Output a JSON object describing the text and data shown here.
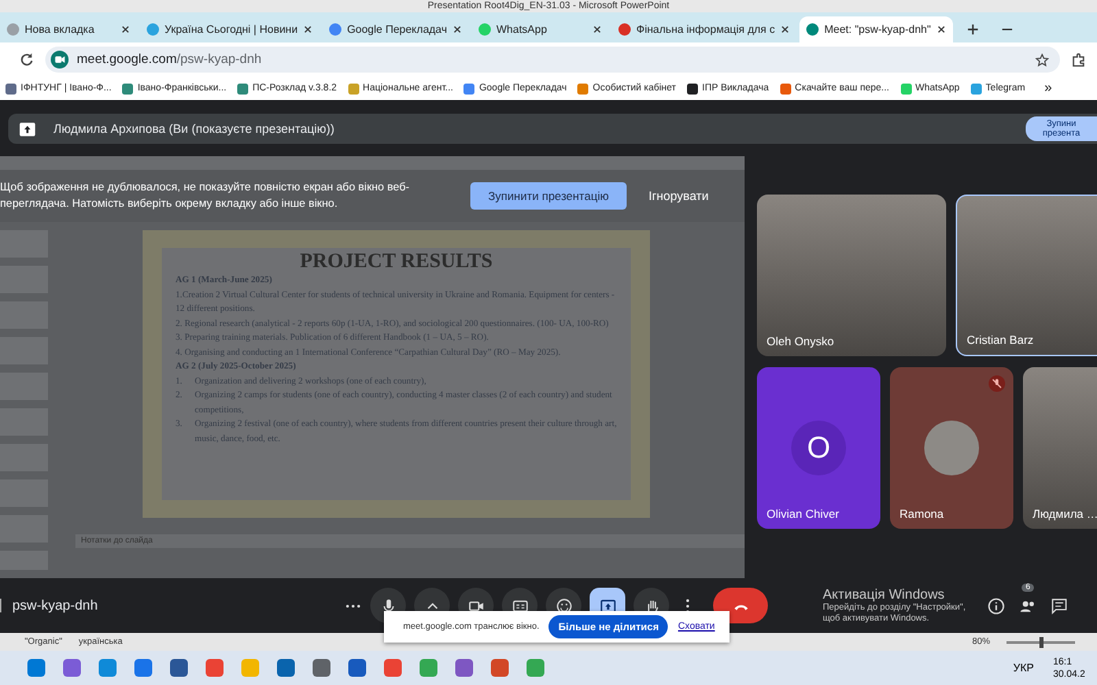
{
  "ppt_title": "Presentation Root4Dig_EN-31.03 - Microsoft PowerPoint",
  "browser": {
    "tabs": [
      {
        "label": "Нова вкладка",
        "selected": false,
        "color": "#9aa0a6"
      },
      {
        "label": "Україна Сьогодні | Новини",
        "selected": false,
        "color": "#2aa3de"
      },
      {
        "label": "Google Перекладач",
        "selected": false,
        "color": "#4285f4"
      },
      {
        "label": "WhatsApp",
        "selected": false,
        "color": "#25d366"
      },
      {
        "label": "Фінальна інформація для с",
        "selected": false,
        "color": "#d93025"
      },
      {
        "label": "Meet: \"psw-kyap-dnh\"",
        "selected": true,
        "color": "#00897b"
      }
    ],
    "url_host": "meet.google.com",
    "url_path": "/psw-kyap-dnh",
    "bookmarks": [
      {
        "label": "ІФНТУНГ | Івано-Ф...",
        "color": "#5f6b8a"
      },
      {
        "label": "Івано-Франківськи...",
        "color": "#2e8b7a"
      },
      {
        "label": "ПС-Розклад v.3.8.2",
        "color": "#2e8b7a"
      },
      {
        "label": "Національне агент...",
        "color": "#c9a227"
      },
      {
        "label": "Google Перекладач",
        "color": "#4285f4"
      },
      {
        "label": "Особистий кабінет",
        "color": "#e07b00"
      },
      {
        "label": "ІПР Викладача",
        "color": "#202124"
      },
      {
        "label": "Скачайте ваш пере...",
        "color": "#e8590c"
      },
      {
        "label": "WhatsApp",
        "color": "#25d366"
      },
      {
        "label": "Telegram",
        "color": "#2aa3de"
      }
    ],
    "more_bookmarks": "»"
  },
  "meet": {
    "presenter_bar": "Людмила Архипова (Ви (показуєте презентацію))",
    "stop_chip": "Зупини презента",
    "banner": {
      "text": "Щоб зображення не дублювалося, не показуйте повністю екран або вікно веб-переглядача. Натомість виберіть окрему вкладку або інше вікно.",
      "stop_button": "Зупинити презентацію",
      "ignore_button": "Ігнорувати"
    },
    "slide": {
      "title": "PROJECT RESULTS",
      "lines": [
        {
          "kind": "heading",
          "text": "AG 1 (March-June 2025)"
        },
        {
          "kind": "para",
          "text": "1.Creation 2 Virtual Cultural Center for students of technical university in Ukraine and Romania. Equipment for centers - 12 different positions."
        },
        {
          "kind": "para",
          "text": "2. Regional research (analytical - 2 reports 60p (1-UA, 1-RO), and sociological 200 questionnaires. (100- UA, 100-RO)"
        },
        {
          "kind": "para",
          "text": "3. Preparing training materials. Publication of 6 different Handbook (1 – UA, 5 – RO)."
        },
        {
          "kind": "para",
          "text": "4. Organising and conducting an 1 International Conference “Carpathian Cultural Day” (RO – May 2025)."
        },
        {
          "kind": "heading",
          "text": "AG 2 (July 2025-October 2025)"
        },
        {
          "kind": "numbered",
          "number": "1.",
          "text": "Organization and delivering 2 workshops (one of each country),"
        },
        {
          "kind": "numbered",
          "number": "2.",
          "text": "Organizing 2 camps for students (one of each country), conducting 4 master classes (2 of each country) and student competitions,"
        },
        {
          "kind": "numbered",
          "number": "3.",
          "text": "Organizing 2 festival (one of each country), where students from different countries present their culture through art, music, dance, food, etc."
        }
      ]
    },
    "notes_placeholder": "Нотатки до слайда",
    "participants": [
      {
        "name": "Oleh Onysko",
        "kind": "video",
        "speaking": false,
        "muted": false
      },
      {
        "name": "Cristian Barz",
        "kind": "video",
        "speaking": true,
        "muted": false
      },
      {
        "name": "Olivian Chiver",
        "kind": "initial",
        "initial": "O",
        "color": "#6a2fd0",
        "speaking": false,
        "muted": false
      },
      {
        "name": "Ramona",
        "kind": "photo_avatar",
        "color": "#6e3b36",
        "speaking": false,
        "muted": true
      },
      {
        "name": "Людмила …",
        "kind": "video",
        "speaking": false,
        "muted": false
      }
    ],
    "meeting_code": "psw-kyap-dnh",
    "controls": [
      {
        "kind": "more_horiz",
        "selected": false
      },
      {
        "kind": "mic",
        "selected": false
      },
      {
        "kind": "caret",
        "selected": false
      },
      {
        "kind": "camera",
        "selected": false
      },
      {
        "kind": "captions",
        "selected": false
      },
      {
        "kind": "emoji",
        "selected": false
      },
      {
        "kind": "present",
        "selected": true
      },
      {
        "kind": "hand",
        "selected": false
      },
      {
        "kind": "more_vert",
        "selected": false
      },
      {
        "kind": "end_call",
        "selected": false
      }
    ],
    "people_count": "6",
    "toast": {
      "text": "meet.google.com транслює вікно.",
      "stop_button": "Більше не ділитися",
      "hide_link": "Сховати"
    }
  },
  "activation": {
    "title": "Активація Windows",
    "text": "Перейдіть до розділу \"Настройки\", щоб активувати Windows."
  },
  "ppt_status": {
    "theme": "\"Organic\"",
    "language": "українська",
    "zoom": "80%",
    "level": 0.5
  },
  "taskbar": {
    "language": "УКР",
    "time": "16:1",
    "date": "30.04.2"
  }
}
